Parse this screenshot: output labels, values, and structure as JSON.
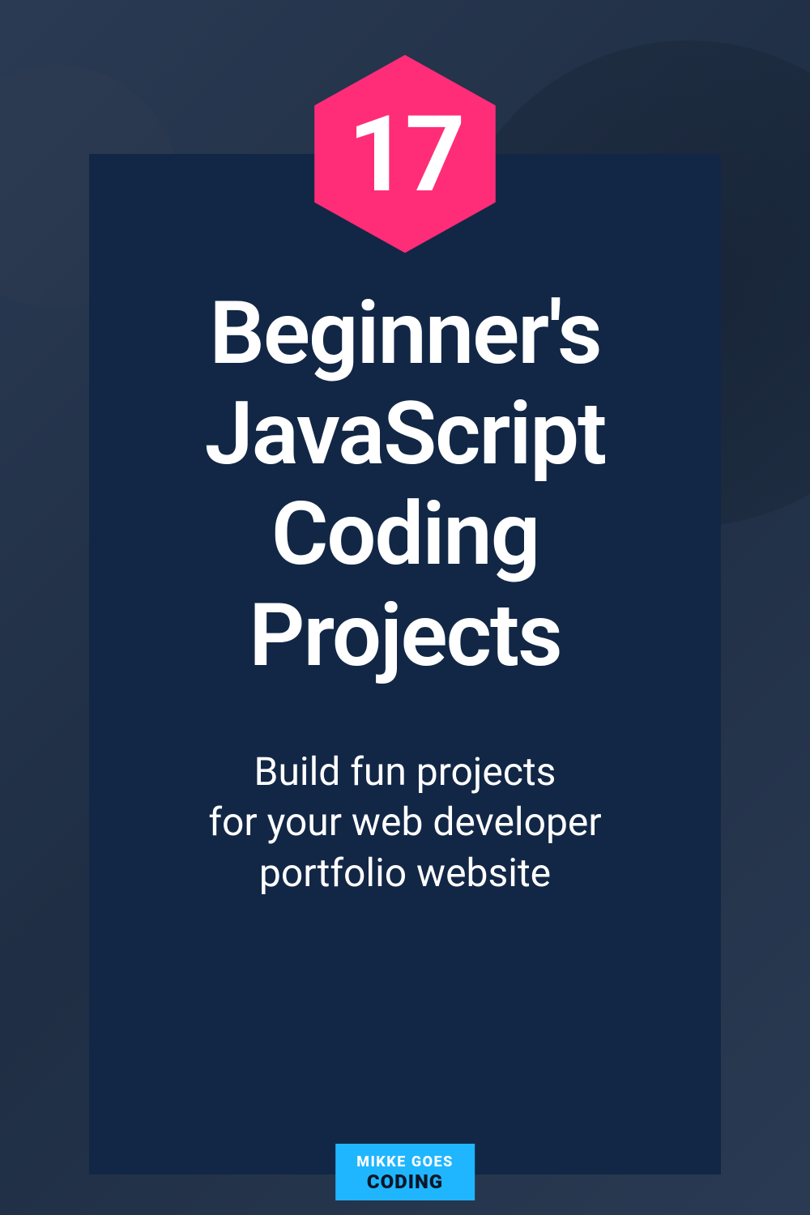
{
  "hexagon": {
    "number": "17",
    "fill": "#ff2d78"
  },
  "title": "Beginner's\nJavaScript\nCoding\nProjects",
  "subtitle": "Build fun projects\nfor your web developer\nportfolio website",
  "logo": {
    "line1": "MIKKE GOES",
    "line2": "CODING",
    "bg": "#1fb6ff"
  }
}
